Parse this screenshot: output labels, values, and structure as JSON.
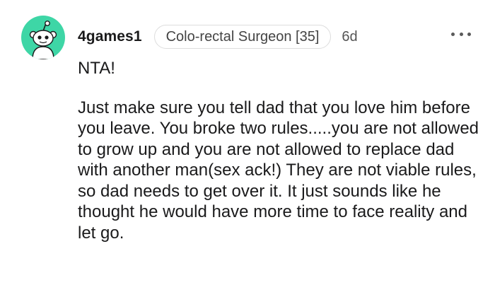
{
  "comment": {
    "username": "4games1",
    "flair": "Colo-rectal Surgeon [35]",
    "timestamp": "6d",
    "avatar_icon": "reddit-snoo-icon",
    "avatar_color": "#3ed6a6",
    "more_icon": "more-horizontal-icon",
    "paragraphs": [
      "NTA!",
      "Just make sure you tell dad that you love him before you leave. You broke two rules.....you are not allowed to grow up and you are not allowed to replace dad with another man(sex ack!) They are not viable rules, so dad needs to get over it. It just sounds like he thought he would have more time to face reality and let go."
    ]
  }
}
